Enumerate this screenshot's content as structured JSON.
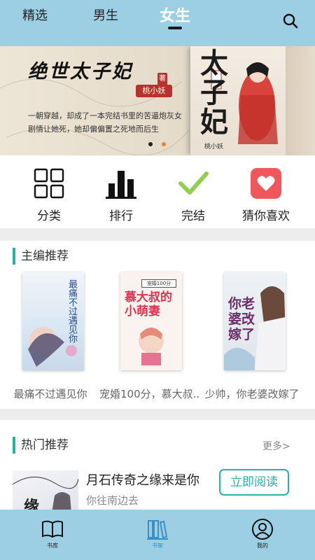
{
  "header": {
    "tabs": [
      {
        "label": "精选"
      },
      {
        "label": "男生"
      },
      {
        "label": "女生",
        "active": true
      }
    ],
    "search_icon": "search-icon"
  },
  "banner": {
    "title": "绝世太子妃",
    "seal": "著",
    "author": "桃小妖",
    "description": "一朝穿越，却成了一本完结书里的苦逼炮灰女剧情让她死，她却偏偏置之死地而后生",
    "cover_title": "太子妃",
    "cover_author": "桃小妖",
    "dots": 2
  },
  "menu": {
    "items": [
      {
        "label": "分类",
        "icon": "grid-icon"
      },
      {
        "label": "排行",
        "icon": "bar-chart-icon"
      },
      {
        "label": "完结",
        "icon": "checkmark-icon"
      },
      {
        "label": "猜你喜欢",
        "icon": "heart-icon"
      }
    ]
  },
  "editor_picks": {
    "title": "主编推荐",
    "books": [
      {
        "title": "最痛不过遇见你",
        "cover_text": "最痛不过遇见你"
      },
      {
        "title": "宠婚100分，慕大叔..",
        "cover_text": "慕大叔的小萌妻",
        "cover_badge": "宠婚100分"
      },
      {
        "title": "少帅，你老婆改嫁了",
        "cover_text": "你老婆改嫁了"
      }
    ]
  },
  "hot": {
    "title": "热门推荐",
    "more": "更多>",
    "book": {
      "title": "月石传奇之缘来是你",
      "author": "你往南边去",
      "read_label": "立即阅读",
      "cover_text": "缘"
    }
  },
  "bottom_nav": {
    "items": [
      {
        "label": "书库",
        "icon": "book-icon"
      },
      {
        "label": "书架",
        "icon": "bookshelf-icon",
        "active": true
      },
      {
        "label": "我的",
        "icon": "user-icon"
      }
    ]
  },
  "colors": {
    "top_bar": "#9ccfe3",
    "accent": "#27b3a3",
    "heart_bg": "#f0575c",
    "check": "#8fd14f",
    "active_tab": "#ffffff",
    "active_nav": "#3a8fc4"
  }
}
